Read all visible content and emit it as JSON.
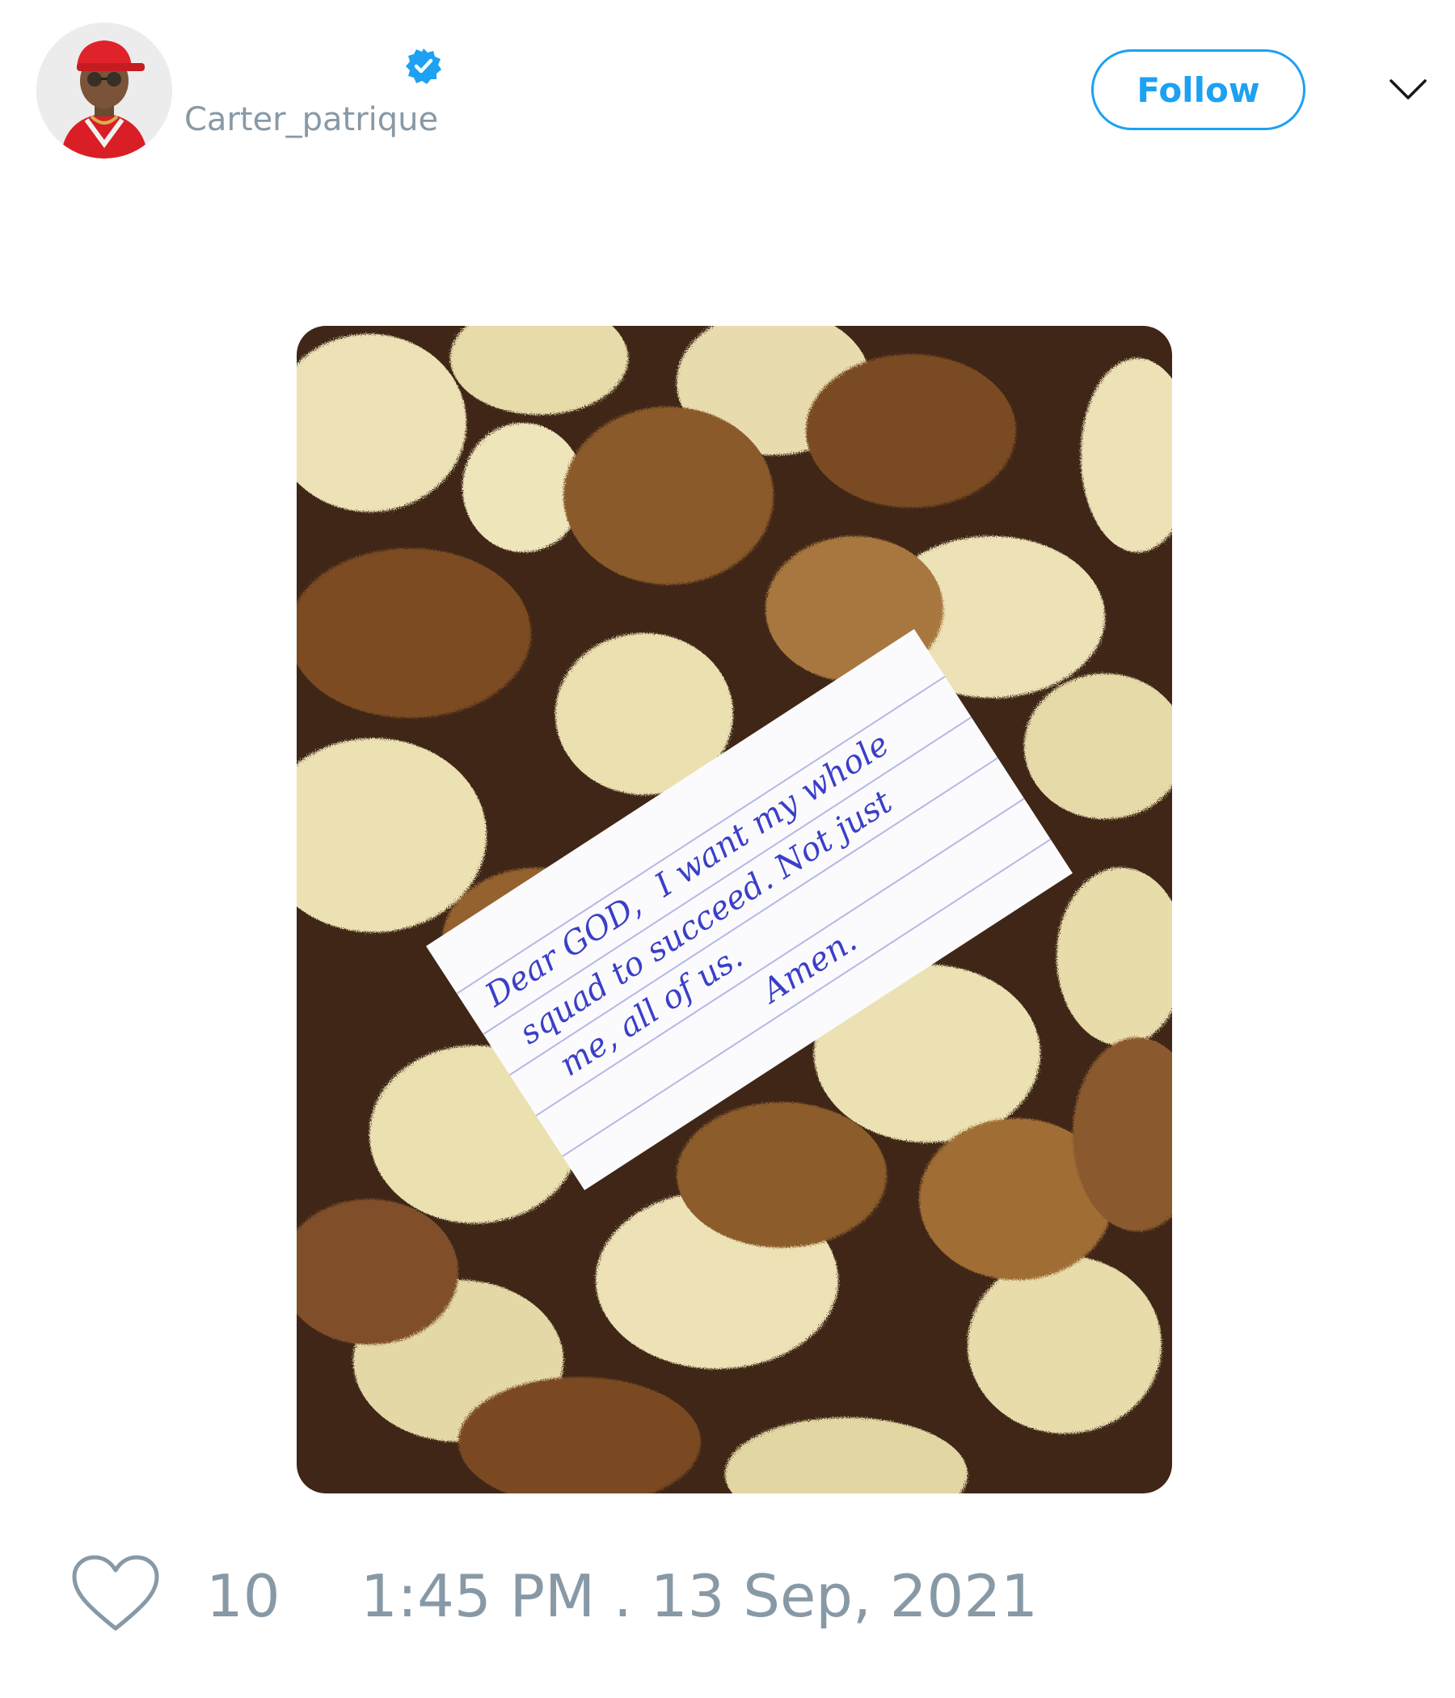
{
  "tweet": {
    "handle": "Carter_patrique",
    "follow_label": "Follow",
    "likes": "10",
    "timestamp": "1:45 PM . 13 Sep, 2021"
  },
  "note": {
    "lines": [
      "Dear GOD,",
      "I want my whole",
      "squad to succeed. Not just",
      "me, all of us.",
      "Amen."
    ]
  },
  "colors": {
    "accent": "#1da1f2",
    "muted": "#8899a6",
    "ink": "#3a3fc8"
  },
  "icons": [
    "verified-badge-icon",
    "chevron-down-icon",
    "heart-icon"
  ]
}
